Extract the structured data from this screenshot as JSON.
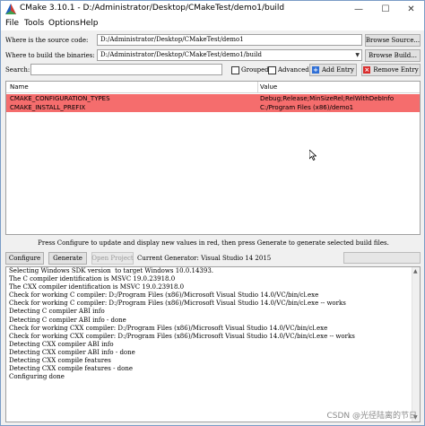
{
  "window": {
    "title": "CMake 3.10.1 - D:/Administrator/Desktop/CMakeTest/demo1/build",
    "minimize_glyph": "—",
    "maximize_glyph": "☐",
    "close_glyph": "✕"
  },
  "menu": {
    "file": "File",
    "tools": "Tools",
    "options": "Options",
    "help": "Help"
  },
  "source": {
    "label": "Where is the source code:",
    "value": "D:/Administrator/Desktop/CMakeTest/demo1",
    "browse_label": "Browse Source..."
  },
  "build": {
    "label": "Where to build the binaries:",
    "value": "D:/Administrator/Desktop/CMakeTest/demo1/build",
    "browse_label": "Browse Build..."
  },
  "search": {
    "label": "Search:",
    "value": "",
    "grouped_label": "Grouped",
    "advanced_label": "Advanced",
    "add_entry_label": "Add Entry",
    "remove_entry_label": "Remove Entry"
  },
  "cache_table": {
    "headers": [
      "Name",
      "Value"
    ],
    "rows": [
      {
        "name": "CMAKE_CONFIGURATION_TYPES",
        "value": "Debug;Release;MinSizeRel;RelWithDebInfo"
      },
      {
        "name": "CMAKE_INSTALL_PREFIX",
        "value": "C:/Program Files (x86)/demo1"
      }
    ],
    "row_color": "#f56d6d"
  },
  "status_message": "Press Configure to update and display new values in red, then press Generate to generate selected build files.",
  "actions": {
    "configure_label": "Configure",
    "generate_label": "Generate",
    "open_project_label": "Open Project",
    "current_generator": "Current Generator: Visual Studio 14 2015"
  },
  "log": [
    "Selecting Windows SDK version  to target Windows 10.0.14393.",
    "The C compiler identification is MSVC 19.0.23918.0",
    "The CXX compiler identification is MSVC 19.0.23918.0",
    "Check for working C compiler: D:/Program Files (x86)/Microsoft Visual Studio 14.0/VC/bin/cl.exe",
    "Check for working C compiler: D:/Program Files (x86)/Microsoft Visual Studio 14.0/VC/bin/cl.exe -- works",
    "Detecting C compiler ABI info",
    "Detecting C compiler ABI info - done",
    "Check for working CXX compiler: D:/Program Files (x86)/Microsoft Visual Studio 14.0/VC/bin/cl.exe",
    "Check for working CXX compiler: D:/Program Files (x86)/Microsoft Visual Studio 14.0/VC/bin/cl.exe -- works",
    "Detecting CXX compiler ABI info",
    "Detecting CXX compiler ABI info - done",
    "Detecting CXX compile features",
    "Detecting CXX compile features - done",
    "Configuring done"
  ],
  "watermark": "CSDN @光径陆离的节日"
}
